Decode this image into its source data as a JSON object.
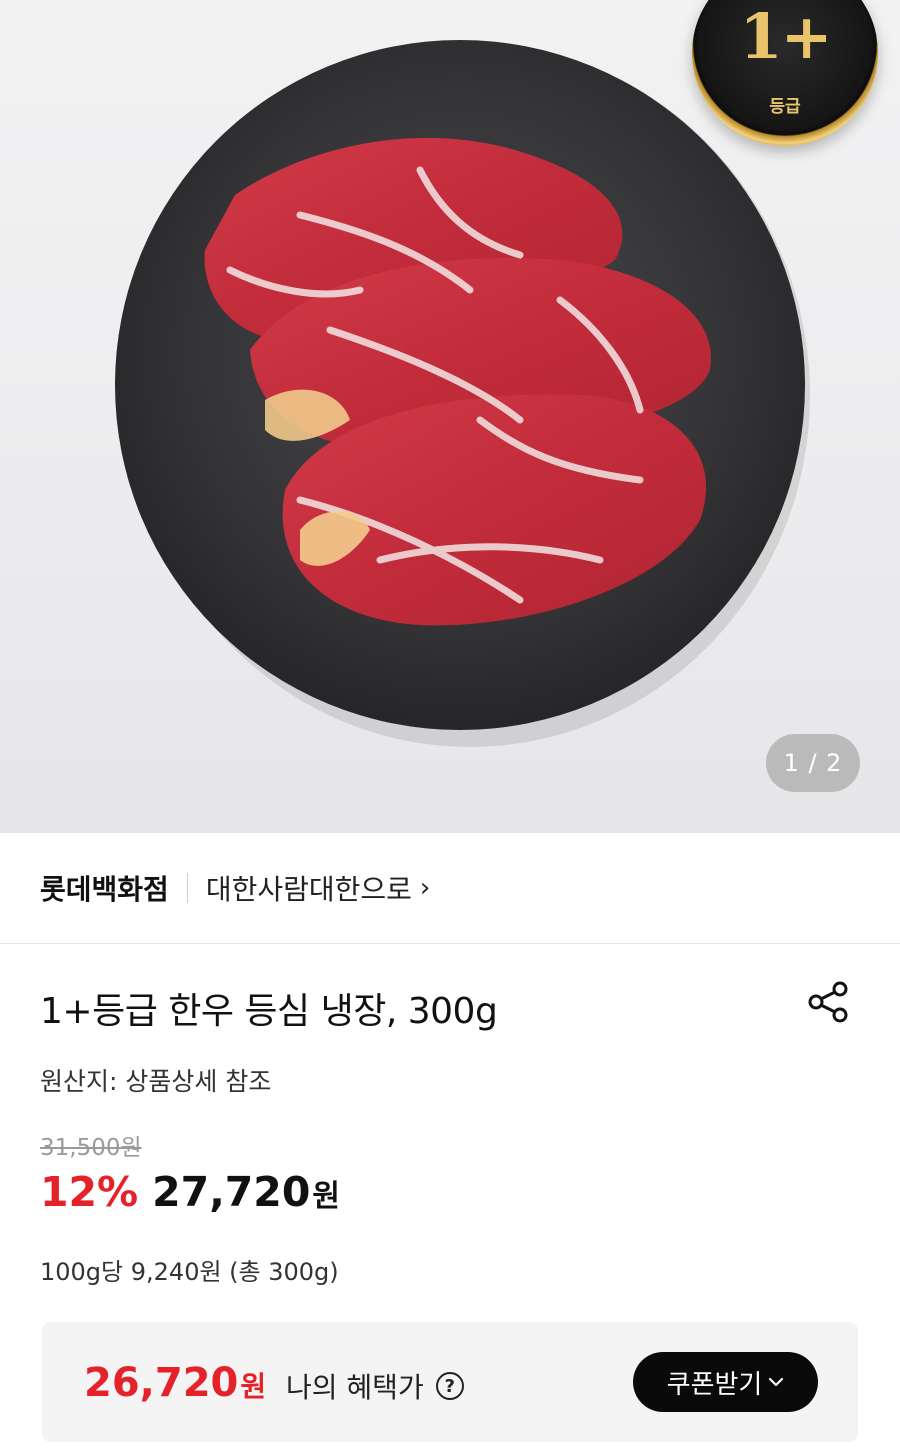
{
  "hero": {
    "grade_badge": {
      "grade": "1+",
      "label": "등급"
    },
    "image_counter": "1 / 2"
  },
  "store": {
    "brand": "롯데백화점",
    "seller": "대한사람대한으로",
    "chevron": "›"
  },
  "product": {
    "title": "1+등급 한우 등심 냉장, 300g",
    "origin": "원산지: 상품상세 참조",
    "original_price": "31,500원",
    "discount": "12%",
    "price": "27,720",
    "currency": "원",
    "unit_price": "100g당 9,240원 (총 300g)"
  },
  "benefit": {
    "price": "26,720",
    "currency": "원",
    "label": "나의 혜택가",
    "help": "?",
    "coupon_button": "쿠폰받기"
  },
  "colors": {
    "accent_red": "#e5222a",
    "button_black": "#0a0a0a",
    "badge_gold": "#e9c46c"
  },
  "icons": [
    "share-icon",
    "help-icon",
    "chevron-down-icon",
    "chevron-right-icon"
  ]
}
